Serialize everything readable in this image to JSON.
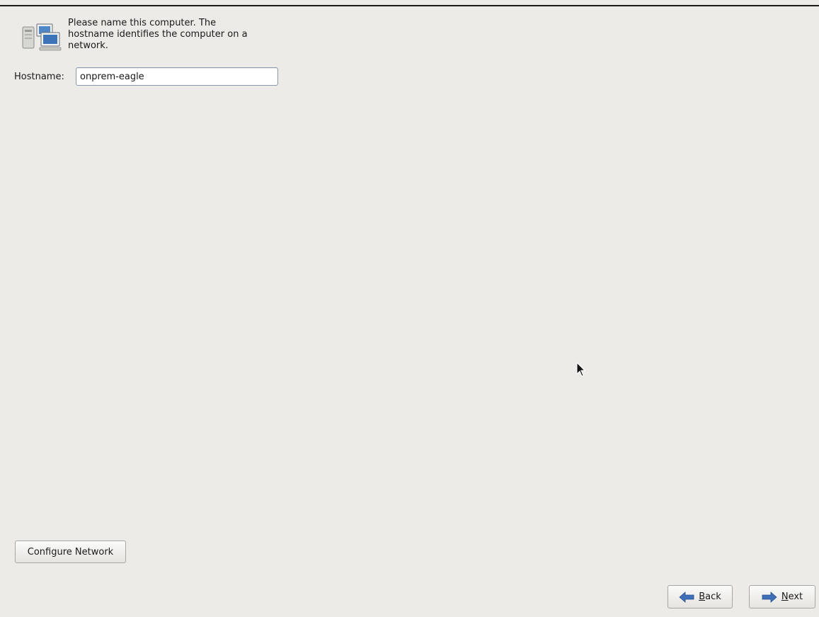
{
  "intro": {
    "icon": "network-computers-icon",
    "line1": "Please name this computer.  The",
    "line2": "hostname identifies the computer on a",
    "line3": "network."
  },
  "hostname": {
    "label": "Hostname:",
    "value": "onprem-eagle"
  },
  "buttons": {
    "configure_network": "Configure Network",
    "back_mnemonic": "B",
    "back_rest": "ack",
    "next_mnemonic": "N",
    "next_rest": "ext"
  },
  "colors": {
    "background": "#edebe8",
    "arrow_blue": "#3e6fb8"
  }
}
